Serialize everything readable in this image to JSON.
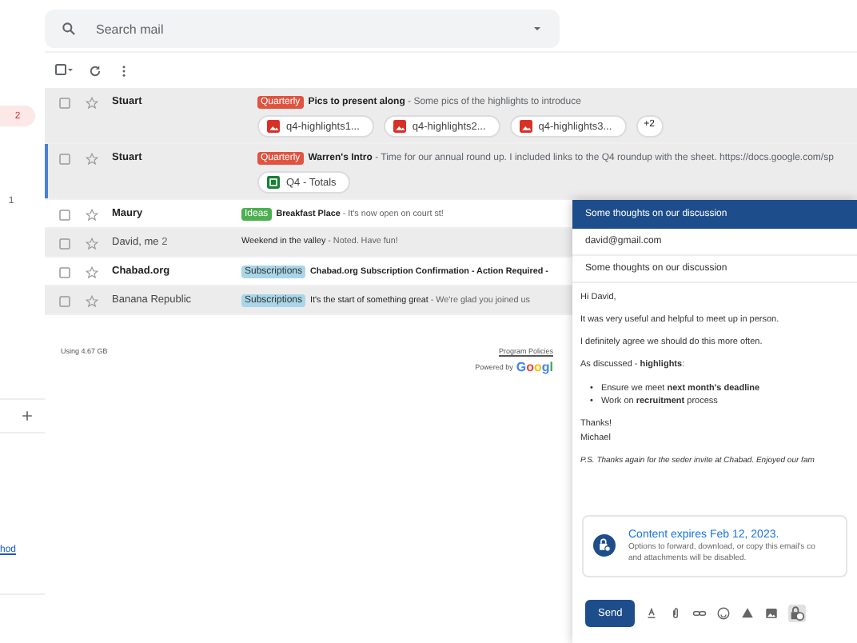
{
  "sidebar": {
    "badges": [
      {
        "text": "2",
        "kind": "pill"
      },
      {
        "text": "1",
        "kind": "plain"
      }
    ],
    "link": "hod"
  },
  "search": {
    "placeholder": "Search mail"
  },
  "rows": [
    {
      "sender": "Stuart",
      "unread": true,
      "shaded": true,
      "focused": false,
      "label": {
        "text": "Quarterly",
        "color": "#e0533f"
      },
      "subject": "Pics to present along",
      "snippet": " - Some pics of the highlights to introduce",
      "attachments": [
        {
          "name": "q4-highlights1...",
          "kind": "image"
        },
        {
          "name": "q4-highlights2...",
          "kind": "image"
        },
        {
          "name": "q4-highlights3...",
          "kind": "image"
        }
      ],
      "more": "+2"
    },
    {
      "sender": "Stuart",
      "unread": true,
      "shaded": true,
      "focused": true,
      "label": {
        "text": "Quarterly",
        "color": "#e0533f"
      },
      "subject": "Warren's Intro",
      "snippet": " - Time for our annual round up. I included links to the Q4 roundup with the sheet. https://docs.google.com/sp",
      "attachments": [
        {
          "name": "Q4 - Totals",
          "kind": "sheet"
        }
      ]
    },
    {
      "sender": "Maury",
      "unread": true,
      "shaded": false,
      "focused": false,
      "label": {
        "text": "Ideas",
        "color": "#4caf50"
      },
      "subject": "Breakfast Place",
      "snippet": " - It's now open on court st!",
      "attachments": []
    },
    {
      "sender": "David, me",
      "count": "2",
      "unread": false,
      "shaded": true,
      "focused": false,
      "subject": "Weekend in the valley",
      "snippet": " - Noted. Have fun!",
      "attachments": []
    },
    {
      "sender": "Chabad.org",
      "unread": true,
      "shaded": false,
      "focused": false,
      "label": {
        "text": "Subscriptions",
        "color": "#a9d6e8"
      },
      "subject": "Chabad.org Subscription Confirmation - Action Required -",
      "snippet": "",
      "attachments": []
    },
    {
      "sender": "Banana Republic",
      "unread": false,
      "shaded": true,
      "focused": false,
      "label": {
        "text": "Subscriptions",
        "color": "#a9d6e8"
      },
      "subject": "It's the start of something great",
      "snippet": " - We're glad you joined us",
      "attachments": []
    }
  ],
  "footer": {
    "storage": "Using 4.67 GB",
    "policies": "Program Policies",
    "powered": "Powered by",
    "logo": "Googl"
  },
  "compose": {
    "title": "Some thoughts on our discussion",
    "to": "david@gmail.com",
    "subject": "Some thoughts on our discussion",
    "body": [
      {
        "kind": "p",
        "text": "Hi David,"
      },
      {
        "kind": "p",
        "text": "It was very useful and helpful to meet up in person."
      },
      {
        "kind": "p",
        "text": "I definitely agree we should do this more often."
      },
      {
        "kind": "p",
        "text": "As discussed - **highlights**:"
      },
      {
        "kind": "list",
        "marker": "•",
        "items": [
          "Ensure we meet **next month's deadline**",
          "Work on **recruitment** process"
        ]
      },
      {
        "kind": "lines",
        "items": [
          "Thanks!",
          "Michael"
        ]
      },
      {
        "kind": "ps",
        "text": "P.S. Thanks again for the seder invite at Chabad. Enjoyed our fam"
      }
    ],
    "notice": {
      "title": "Content expires Feb 12, 2023.",
      "lines": [
        "Options to forward, download, or copy this email's co",
        "and attachments will be disabled."
      ]
    },
    "send": "Send",
    "confidential_on": true
  }
}
